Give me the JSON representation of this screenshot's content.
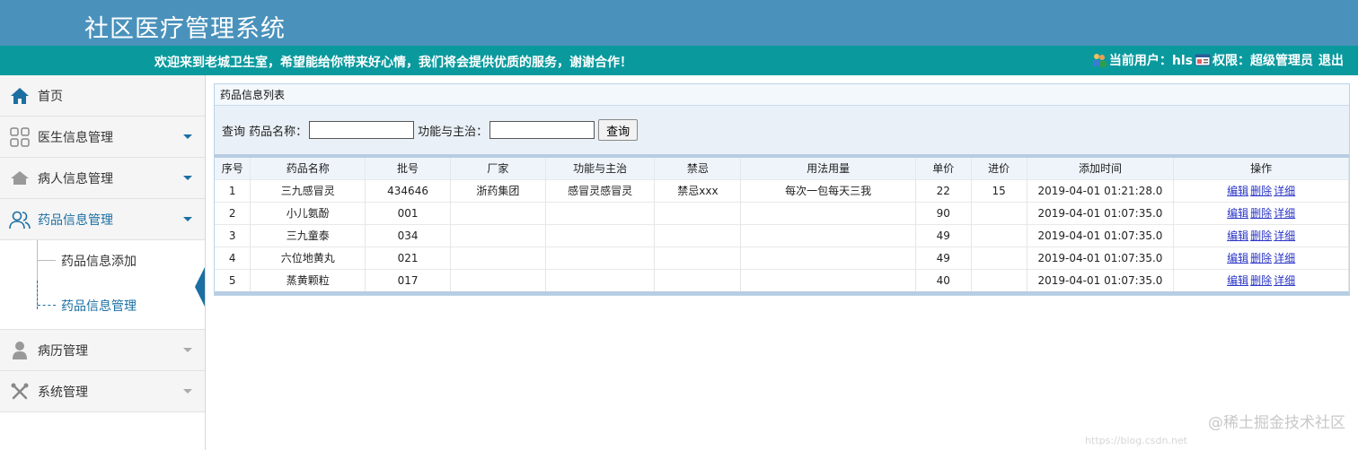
{
  "app": {
    "title": "社区医疗管理系统",
    "welcome": "欢迎来到老城卫生室，希望能给你带来好心情，我们将会提供优质的服务，谢谢合作！",
    "current_user_label": "当前用户：hls",
    "permission_label": "权限：超级管理员",
    "logout_label": "退出"
  },
  "sidebar": {
    "home": "首页",
    "items": [
      {
        "label": "医生信息管理"
      },
      {
        "label": "病人信息管理"
      },
      {
        "label": "药品信息管理"
      },
      {
        "label": "病历管理"
      },
      {
        "label": "系统管理"
      }
    ],
    "submenu": [
      {
        "label": "药品信息添加"
      },
      {
        "label": "药品信息管理"
      }
    ]
  },
  "panel": {
    "title": "药品信息列表",
    "search_prefix": "查询 药品名称：",
    "function_label": "功能与主治：",
    "query_button": "查询"
  },
  "table": {
    "headers": [
      "序号",
      "药品名称",
      "批号",
      "厂家",
      "功能与主治",
      "禁忌",
      "用法用量",
      "单价",
      "进价",
      "添加时间",
      "操作"
    ],
    "rows": [
      [
        "1",
        "三九感冒灵",
        "434646",
        "浙药集团",
        "感冒灵感冒灵",
        "禁忌xxx",
        "每次一包每天三我",
        "22",
        "15",
        "2019-04-01 01:21:28.0"
      ],
      [
        "2",
        "小儿氨酚",
        "001",
        "",
        "",
        "",
        "",
        "90",
        "",
        "2019-04-01 01:07:35.0"
      ],
      [
        "3",
        "三九童泰",
        "034",
        "",
        "",
        "",
        "",
        "49",
        "",
        "2019-04-01 01:07:35.0"
      ],
      [
        "4",
        "六位地黄丸",
        "021",
        "",
        "",
        "",
        "",
        "49",
        "",
        "2019-04-01 01:07:35.0"
      ],
      [
        "5",
        "蒸黄颗粒",
        "017",
        "",
        "",
        "",
        "",
        "40",
        "",
        "2019-04-01 01:07:35.0"
      ]
    ],
    "ops": [
      "编辑",
      "删除",
      "详细"
    ]
  },
  "watermark": {
    "text": "@稀土掘金技术社区",
    "sub": "https://blog.csdn.net"
  },
  "colors": {
    "header": "#4a92bc",
    "infobar": "#0a9a9e",
    "accent": "#1b6fa3",
    "link": "#2a35c6"
  }
}
